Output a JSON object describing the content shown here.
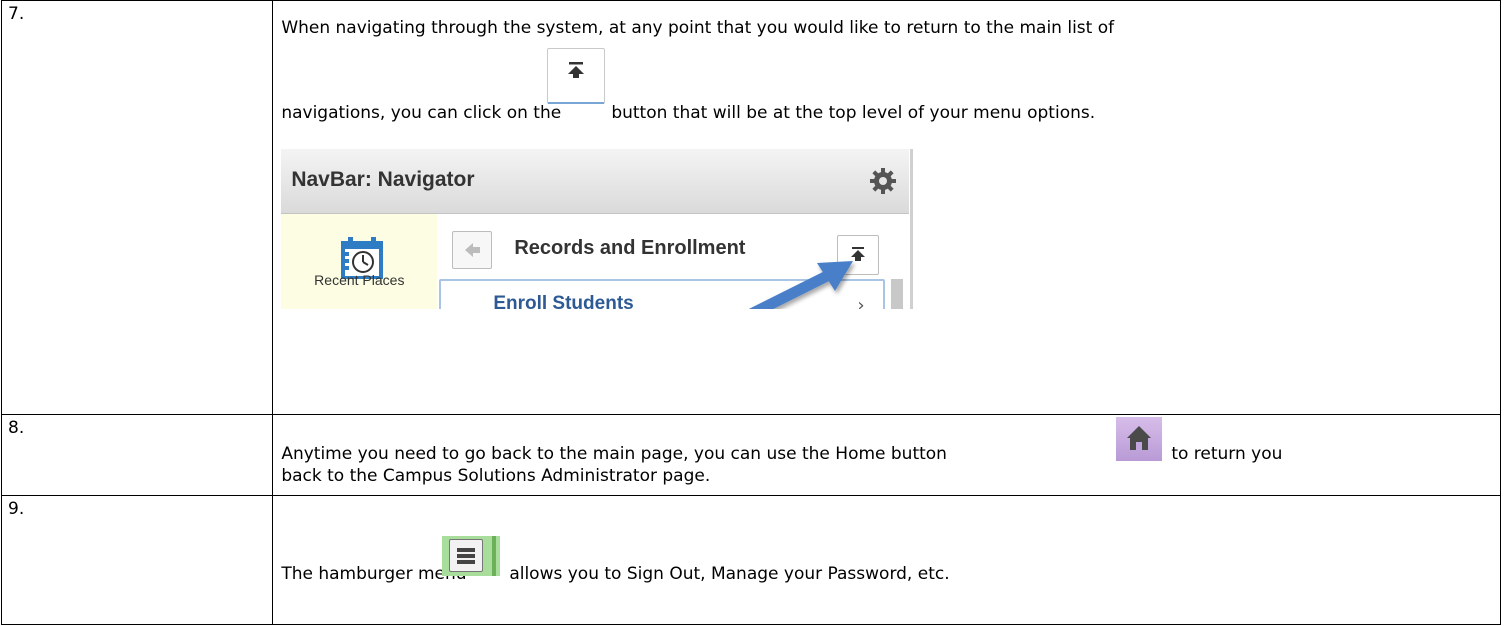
{
  "steps": [
    {
      "number": "7.",
      "line1": "When navigating through the system, at any point that you would like to return to the main list of",
      "line2_before": "navigations, you can click on the",
      "line2_after": "button that will be at the top level of your menu options."
    },
    {
      "number": "8.",
      "line1_before": "Anytime you need to go back to the main page, you can use the Home button",
      "line1_after": "to return you",
      "line2": "back to the Campus Solutions Administrator page."
    },
    {
      "number": "9.",
      "line1_before": "The hamburger menu",
      "line1_after": "allows you to Sign Out, Manage your Password, etc."
    }
  ],
  "navigator": {
    "title": "NavBar: Navigator",
    "recent_places": "Recent Places",
    "section_title": "Records and Enrollment",
    "item_label": "Enroll Students",
    "chevron": "›"
  },
  "icons": {
    "top_level": "top-level-icon",
    "gear": "gear-icon",
    "calendar": "calendar-clock-icon",
    "back": "back-arrow-icon",
    "home": "home-icon",
    "hamburger": "hamburger-menu-icon",
    "pointer_arrow": "pointer-arrow-icon"
  },
  "colors": {
    "link_blue": "#2d5a94",
    "arrow_blue": "#4a7fc9",
    "home_purple": "#c6a9e0",
    "menu_green": "#a9dd9b",
    "recent_bg": "#fdfde3"
  }
}
